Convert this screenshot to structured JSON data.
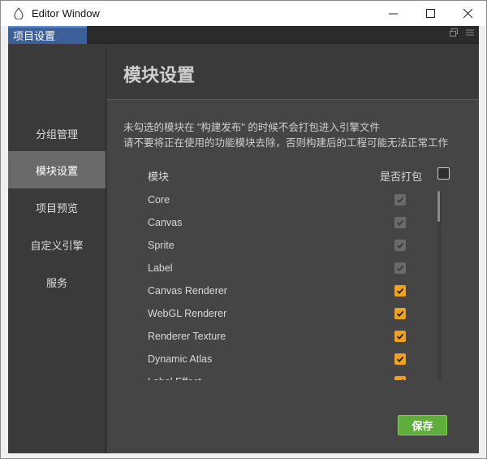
{
  "window": {
    "title": "Editor Window",
    "controls": {
      "minimize": "—",
      "maximize": "☐",
      "close": "✕"
    }
  },
  "tab": {
    "label": "项目设置"
  },
  "sidebar": {
    "items": [
      {
        "label": "分组管理",
        "active": false
      },
      {
        "label": "模块设置",
        "active": true
      },
      {
        "label": "项目预览",
        "active": false
      },
      {
        "label": "自定义引擎",
        "active": false
      },
      {
        "label": "服务",
        "active": false
      }
    ]
  },
  "main": {
    "title": "模块设置",
    "description_line1": "未勾选的模块在 \"构建发布\" 的时候不会打包进入引擎文件",
    "description_line2": "请不要将正在使用的功能模块去除，否则构建后的工程可能无法正常工作",
    "column_module": "模块",
    "column_pack": "是否打包",
    "modules": [
      {
        "name": "Core",
        "checked": true,
        "disabled": true
      },
      {
        "name": "Canvas",
        "checked": true,
        "disabled": true
      },
      {
        "name": "Sprite",
        "checked": true,
        "disabled": true
      },
      {
        "name": "Label",
        "checked": true,
        "disabled": true
      },
      {
        "name": "Canvas Renderer",
        "checked": true,
        "disabled": false
      },
      {
        "name": "WebGL Renderer",
        "checked": true,
        "disabled": false
      },
      {
        "name": "Renderer Texture",
        "checked": true,
        "disabled": false
      },
      {
        "name": "Dynamic Atlas",
        "checked": true,
        "disabled": false
      },
      {
        "name": "Label Effect",
        "checked": true,
        "disabled": false
      }
    ],
    "save_label": "保存"
  },
  "colors": {
    "accent_checkbox": "#f0a21b",
    "save_button": "#5fae3b",
    "tab_active": "#3d5f9a"
  }
}
